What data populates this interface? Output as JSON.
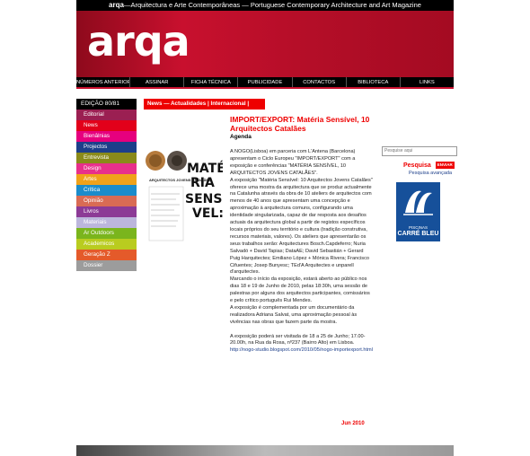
{
  "header": {
    "brand": "arqa",
    "tagline": "—Arquitectura e Arte Contemporâneas — Portuguese Contemporary Architecture and Art Magazine",
    "logo_text": "arqa"
  },
  "nav": [
    "NÚMEROS ANTERIORES",
    "ASSINAR",
    "FICHA TÉCNICA",
    "PUBLICIDADE",
    "CONTACTOS",
    "BIBLIOTECA",
    "LINKS"
  ],
  "sidebar": {
    "edition": "EDIÇÃO 80/81",
    "items": [
      {
        "label": "Editorial",
        "color": "#9b1f52"
      },
      {
        "label": "News",
        "color": "#e2001a"
      },
      {
        "label": "Bienâlnias",
        "color": "#e6007e"
      },
      {
        "label": "Projectos",
        "color": "#1d3f8a"
      },
      {
        "label": "Entrevista",
        "color": "#8a8a1a"
      },
      {
        "label": "Design",
        "color": "#e8308b"
      },
      {
        "label": "Artes",
        "color": "#f0a21a"
      },
      {
        "label": "Crítica",
        "color": "#1b8ccb"
      },
      {
        "label": "Opinião",
        "color": "#d96b54"
      },
      {
        "label": "Livros",
        "color": "#8c3a96"
      },
      {
        "label": "Materiais",
        "color": "#bcb6dc"
      },
      {
        "label": "Ar Outdoors",
        "color": "#7ab51d"
      },
      {
        "label": "Academicos",
        "color": "#b9cc1f"
      },
      {
        "label": "Geração Z",
        "color": "#e45a2a"
      },
      {
        "label": "Dossier",
        "color": "#9c9c9c"
      }
    ]
  },
  "newsbar": "News — Actualidades | Internacional |",
  "article": {
    "title": "IMPORT/EXPORT: Matéria Sensível, 10 Arquitectos Catalães",
    "subtitle": "Agenda",
    "paragraphs": [
      "A NOGO(Lisboa) em parceria com L'Antena (Barcelona) apresentam o Ciclo Europeu \"IMPORT/EXPORT\" com a exposição e conferências \"MATÉRIA SENSÍVEL, 10 ARQUITECTOS JOVENS CATALÃES\".",
      "A exposição \"Matéria Sensível: 10 Arquitectos Jovens Catalães\" oferece uma mostra da arquitectura que se produz actualmente na Catalunha através da obra de 10 ateliers de arquitectos com menos de 40 anos que apresentam uma concepção e aproximação à arquitectura comuns, configurando uma identidade singularizada, capaz de dar resposta aos desafios actuais da arquitectura global a partir de registos específicos locais próprios do seu território e cultura (tradição construtiva, recursos materiais, valores). Os ateliers que apresentarão os seus trabalhos serão: Arquitectures Bosch.Capdeferro; Nuria Salvadó + David Tapias; DataAE; David Sebastián + Gerard Puig Harquitectes; Emiliano López + Mónica Rivera; Francisco Cifuentes; Josep Bunyesc; TEd'A Arquitectes e unparell d'arquitectes.",
      "Marcando o início da exposição, estará aberto ao público nos dias 18 e 19 de Junho de 2010, pelas 18:30h, uma sessão de palestras por alguns dos arquitectos participantes, comissários e pelo crítico português Rui Mendes.",
      "A exposição é complementada por um documentário da realizadora Adriana Salvat, uma aproximação pessoal às vivências nas obras que fazem parte da mostra.",
      "A exposição poderá ser visitada de 18 a 25 de Junho; 17.00-20.00h, na Rua da Rosa, nº237 (Bairro Alto) em Lisboa."
    ],
    "link": "http://nogo-studio.blogspot.com/2010/05/nogo-importexport.html",
    "date": "Jun 2010"
  },
  "thumb": {
    "line1": "MATÉ-",
    "line2": "RIA",
    "line3": "SENSÍ-",
    "line4": "VEL:",
    "caption": "ARQUITECTOS JOVENS CATALÃES"
  },
  "search": {
    "placeholder": "Pesquise aqui",
    "label": "Pesquisa",
    "button": "ENVIAR",
    "advanced": "Pesquisa avançada"
  },
  "ad": {
    "line1": "PISCINAS",
    "line2": "CARRÉ BLEU"
  }
}
